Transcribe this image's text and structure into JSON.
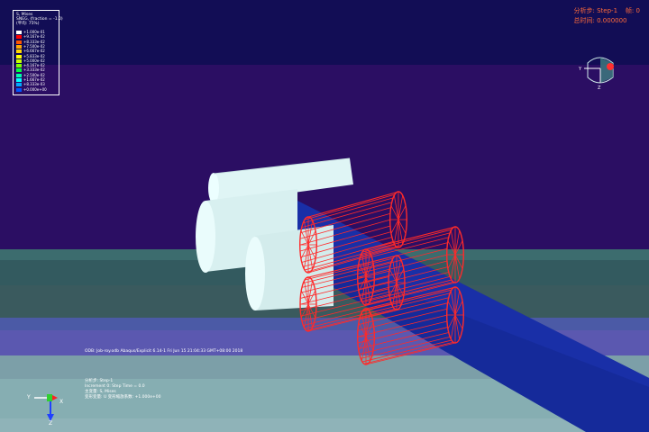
{
  "legend": {
    "title": "S, Mises",
    "subtitle": "SNEG, (fraction = -1.0)",
    "avg": "(平均: 75%)",
    "colors": [
      "#ffffff",
      "#ff0000",
      "#ff5500",
      "#ffaa00",
      "#ffd800",
      "#ffff00",
      "#c8ff00",
      "#7fff00",
      "#00ff40",
      "#00ffaa",
      "#00ffff",
      "#00aaff",
      "#0055ff",
      "#0000ff",
      "#ffffff"
    ],
    "values": [
      "+1.000e-01",
      "+9.167e-02",
      "+8.333e-02",
      "+7.500e-02",
      "+6.667e-02",
      "+5.833e-02",
      "+5.000e-02",
      "+4.167e-02",
      "+3.333e-02",
      "+2.500e-02",
      "+1.667e-02",
      "+8.333e-03",
      "+0.000e+00"
    ]
  },
  "step_info": {
    "line1_label": "分析步:",
    "line1_value": "Step-1",
    "frame_label": "帧:",
    "frame_value": "0",
    "line2_label": "总时间:",
    "line2_value": "0.000000"
  },
  "odb_info": "ODB: Job-roy.odb    Abaqus/Explicit 6.14-1    Fri Jun 15 21:04:33 GMT+08:00 2018",
  "footer_info": {
    "line1": "分析步: Step-1",
    "line2": "Increment       0: Step Time =    0.0",
    "line3": "主变量: S, Mises",
    "line4": "变形变量: U   变形缩放系数: +1.000e+00"
  },
  "triad": {
    "small_y": "Y",
    "small_x": "X",
    "small_z": "Z",
    "orient_y": "Y",
    "orient_z": "Z"
  },
  "colors": {
    "sky": "#1a1560",
    "mesh_red": "#ff2a2a",
    "strip_blue": "#152a9a",
    "roll_white": "#dff5f5"
  }
}
